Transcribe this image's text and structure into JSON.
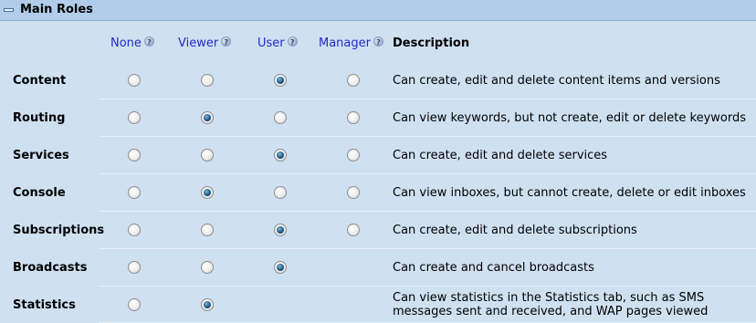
{
  "panel": {
    "title": "Main Roles"
  },
  "columns": {
    "none": "None",
    "viewer": "Viewer",
    "user": "User",
    "manager": "Manager",
    "description": "Description"
  },
  "roles": [
    {
      "name": "Content",
      "selected": "user",
      "options": [
        "none",
        "viewer",
        "user",
        "manager"
      ],
      "description": "Can create, edit and delete content items and versions"
    },
    {
      "name": "Routing",
      "selected": "viewer",
      "options": [
        "none",
        "viewer",
        "user",
        "manager"
      ],
      "description": "Can view keywords, but not create, edit or delete keywords"
    },
    {
      "name": "Services",
      "selected": "user",
      "options": [
        "none",
        "viewer",
        "user",
        "manager"
      ],
      "description": "Can create, edit and delete services"
    },
    {
      "name": "Console",
      "selected": "viewer",
      "options": [
        "none",
        "viewer",
        "user",
        "manager"
      ],
      "description": "Can view inboxes, but cannot create, delete or edit inboxes"
    },
    {
      "name": "Subscriptions",
      "selected": "user",
      "options": [
        "none",
        "viewer",
        "user",
        "manager"
      ],
      "description": "Can create, edit and delete subscriptions"
    },
    {
      "name": "Broadcasts",
      "selected": "user",
      "options": [
        "none",
        "viewer",
        "user"
      ],
      "description": "Can create and cancel broadcasts"
    },
    {
      "name": "Statistics",
      "selected": "viewer",
      "options": [
        "none",
        "viewer"
      ],
      "description": "Can view statistics in the Statistics tab, such as SMS messages sent and received, and WAP pages viewed"
    }
  ]
}
